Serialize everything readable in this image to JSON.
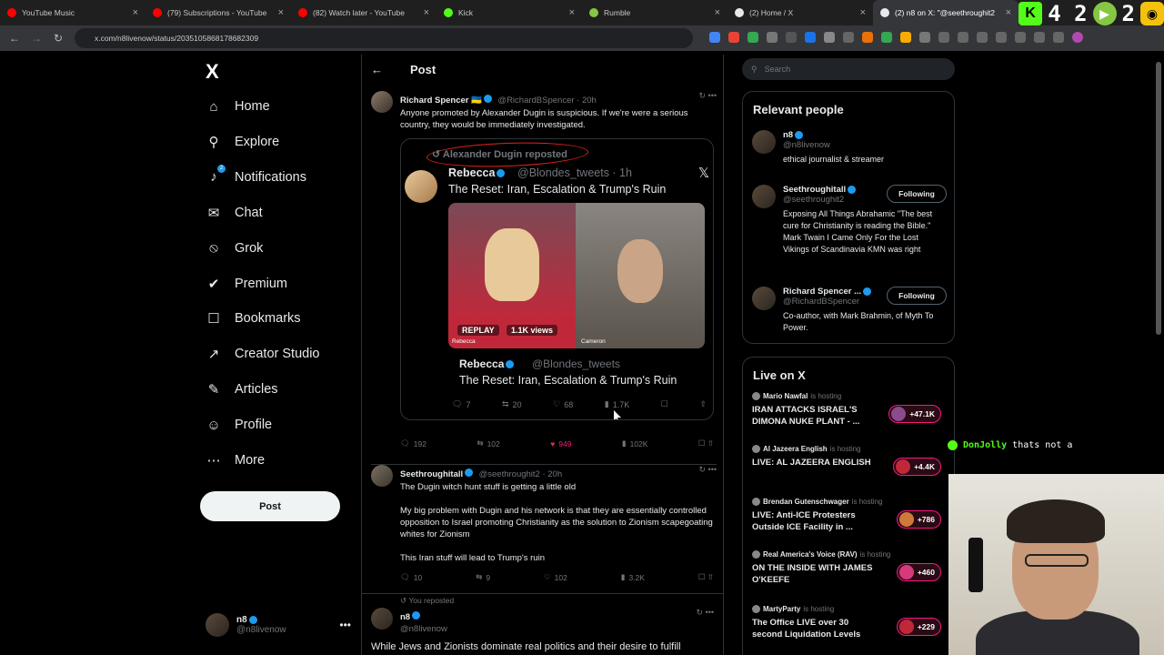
{
  "browser": {
    "tabs": [
      {
        "title": "YouTube Music",
        "color": "#ff0000"
      },
      {
        "title": "(79) Subscriptions - YouTube",
        "color": "#ff0000"
      },
      {
        "title": "(82) Watch later - YouTube",
        "color": "#ff0000"
      },
      {
        "title": "Kick",
        "color": "#53fc18"
      },
      {
        "title": "Rumble",
        "color": "#85c742"
      },
      {
        "title": "(2) Home / X",
        "color": "#e7e9ea"
      },
      {
        "title": "(2) n8 on X: \"@seethroughit2",
        "color": "#e7e9ea"
      }
    ],
    "url": "x.com/n8livenow/status/2035105868178682309",
    "overlay_num1": "4 2",
    "overlay_num2": "2"
  },
  "sidebar": {
    "logo": "X",
    "items": [
      {
        "label": "Home",
        "icon": "home-icon"
      },
      {
        "label": "Explore",
        "icon": "search-icon"
      },
      {
        "label": "Notifications",
        "icon": "bell-icon"
      },
      {
        "label": "Chat",
        "icon": "mail-icon"
      },
      {
        "label": "Grok",
        "icon": "grok-icon"
      },
      {
        "label": "Premium",
        "icon": "premium-icon"
      },
      {
        "label": "Bookmarks",
        "icon": "bookmark-icon"
      },
      {
        "label": "Creator Studio",
        "icon": "rocket-icon"
      },
      {
        "label": "Articles",
        "icon": "article-icon"
      },
      {
        "label": "Profile",
        "icon": "person-icon"
      },
      {
        "label": "More",
        "icon": "more-icon"
      }
    ],
    "notif_badge": "2",
    "post_label": "Post",
    "me_name": "n8",
    "me_handle": "@n8livenow"
  },
  "center": {
    "title": "Post",
    "tweet1": {
      "name": "Richard Spencer 🇺🇦",
      "meta": "@RichardBSpencer · 20h",
      "text": "Anyone promoted by Alexander Dugin is suspicious. If we're were a serious country, they would be immediately investigated.",
      "embed": {
        "reposted": "Alexander Dugin reposted",
        "name": "Rebecca",
        "handle": "@Blondes_tweets · 1h",
        "title": "The Reset: Iran, Escalation & Trump's Ruin",
        "replay": "REPLAY",
        "views": "1.1K views",
        "left_name": "Rebecca",
        "right_name": "Cameron",
        "name2": "Rebecca",
        "handle2": "@Blondes_tweets",
        "title2": "The Reset: Iran, Escalation & Trump's Ruin",
        "replies": "7",
        "reposts": "20",
        "likes": "68",
        "views_count": "1.7K"
      },
      "replies": "192",
      "reposts": "102",
      "likes": "949",
      "views": "102K"
    },
    "tweet2": {
      "name": "Seethroughitall",
      "meta": "@seethroughit2 · 20h",
      "p1": "The Dugin witch hunt stuff is getting a little old",
      "p2": "My big problem with Dugin and his network is that they are essentially controlled opposition to Israel promoting Christianity as the solution to Zionism scapegoating whites for Zionism",
      "p3": "This Iran stuff will lead to Trump's ruin",
      "replies": "10",
      "reposts": "9",
      "likes": "102",
      "views": "3.2K"
    },
    "tweet3": {
      "reposted": "You reposted",
      "name": "n8",
      "handle": "@n8livenow",
      "text": "While Jews and Zionists dominate real politics and their desire to fulfill"
    }
  },
  "right": {
    "search_placeholder": "Search",
    "relevant_title": "Relevant people",
    "people": [
      {
        "name": "n8",
        "handle": "@n8livenow",
        "bio": "ethical journalist & streamer",
        "follow": ""
      },
      {
        "name": "Seethroughitall",
        "handle": "@seethroughit2",
        "bio": "Exposing All Things Abrahamic \"The best cure for Christianity is reading the Bible.\" Mark Twain I Came Only For the Lost Vikings of Scandinavia KMN was right",
        "follow": "Following"
      },
      {
        "name": "Richard Spencer ...",
        "handle": "@RichardBSpencer",
        "bio": "Co-author, with Mark Brahmin, of Myth To Power.",
        "follow": "Following"
      }
    ],
    "live_title": "Live on X",
    "live": [
      {
        "host": "Mario Nawfal",
        "hosting": "is hosting",
        "title": "IRAN ATTACKS ISRAEL'S DIMONA NUKE PLANT - ...",
        "count": "+47.1K"
      },
      {
        "host": "Al Jazeera English",
        "hosting": "is hosting",
        "title": "LIVE: AL JAZEERA ENGLISH",
        "count": "+4.4K"
      },
      {
        "host": "Brendan Gutenschwager",
        "hosting": "is hosting",
        "title": "LIVE: Anti-ICE Protesters Outside ICE Facility in ...",
        "count": "+786"
      },
      {
        "host": "Real America's Voice (RAV)",
        "hosting": "is hosting",
        "title": "ON THE INSIDE WITH JAMES O'KEEFE",
        "count": "+460"
      },
      {
        "host": "MartyParty",
        "hosting": "is hosting",
        "title": "The Office LIVE over 30 second Liquidation Levels",
        "count": "+229"
      }
    ]
  },
  "chat": {
    "user": "DonJolly",
    "message": "thats not a"
  }
}
